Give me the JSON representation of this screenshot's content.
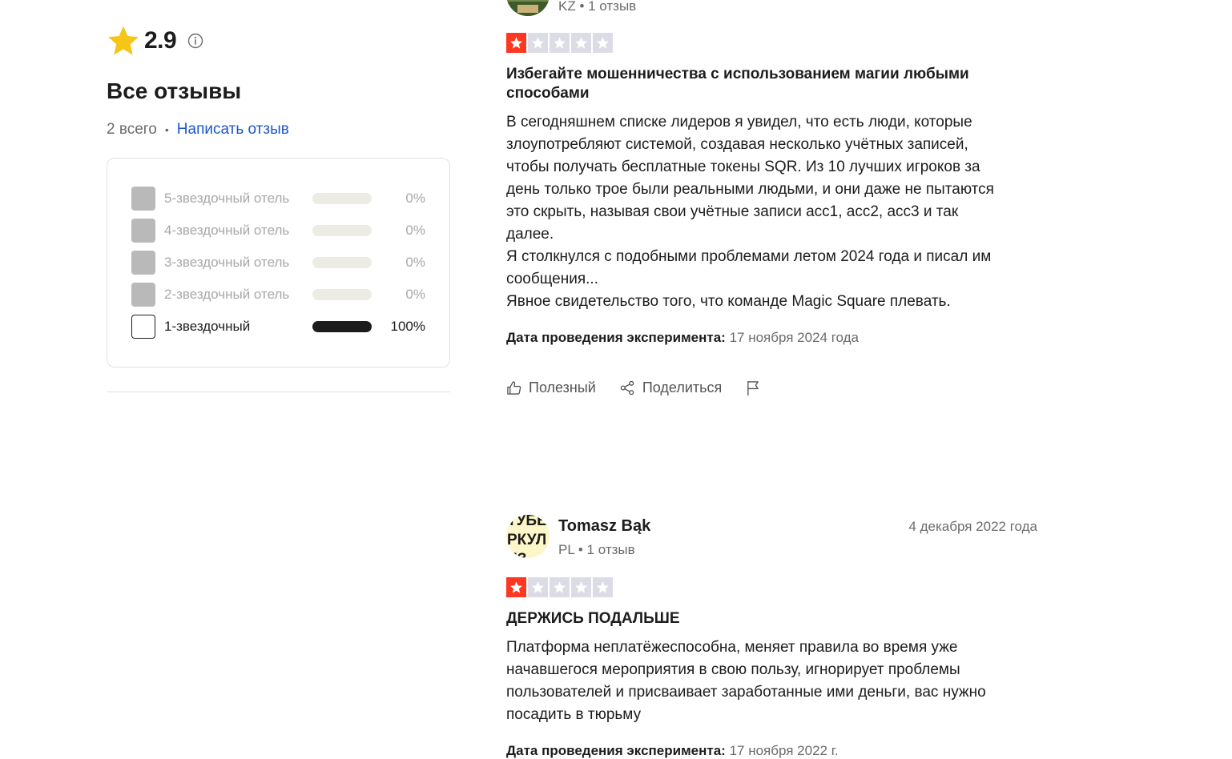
{
  "summary": {
    "rating": "2.9",
    "heading": "Все отзывы",
    "total": "2 всего",
    "write_review": "Написать отзыв"
  },
  "filters": [
    {
      "label": "5-звездочный отель",
      "percent": "0%",
      "fill": 0,
      "enabled": false
    },
    {
      "label": "4-звездочный отель",
      "percent": "0%",
      "fill": 0,
      "enabled": false
    },
    {
      "label": "3-звездочный отель",
      "percent": "0%",
      "fill": 0,
      "enabled": false
    },
    {
      "label": "2-звездочный отель",
      "percent": "0%",
      "fill": 0,
      "enabled": false
    },
    {
      "label": "1-звездочный",
      "percent": "100%",
      "fill": 1,
      "enabled": true
    }
  ],
  "reviews": [
    {
      "author_meta": "KZ • 1 отзыв",
      "stars": 1,
      "title": "Избегайте мошенничества с использованием магии любыми способами",
      "body": [
        "В сегодняшнем списке лидеров я увидел, что есть люди, которые",
        "злоупотребляют системой, создавая несколько учётных записей,",
        "чтобы получать бесплатные токены SQR. Из 10 лучших игроков за",
        "день только трое были реальными людьми, и они даже не пытаются",
        "это скрыть, называя свои учётные записи acc1, acc2, acc3 и так",
        "далее.",
        "Я столкнулся с подобными проблемами летом 2024 года и писал им",
        "сообщения...",
        "Явное свидетельство того, что команде Magic Square плевать."
      ],
      "exp_label": "Дата проведения эксперимента:",
      "exp_value": "17 ноября 2024 года",
      "useful": "Полезный",
      "share": "Поделиться"
    },
    {
      "author_name": "Tomasz Bąk",
      "author_meta": "PL • 1 отзыв",
      "avatar_text": [
        "ТУБЕ",
        "РКУЛ",
        "ЕЗ"
      ],
      "date": "4 декабря 2022 года",
      "stars": 1,
      "title": "ДЕРЖИСЬ ПОДАЛЬШЕ",
      "body": [
        "Платформа неплатёжеспособна, меняет правила во время уже",
        "начавшегося мероприятия в свою пользу, игнорирует проблемы",
        "пользователей и присваивает заработанные ими деньги, вас нужно",
        "посадить в тюрьму"
      ],
      "exp_label": "Дата проведения эксперимента:",
      "exp_value": "17 ноября 2022 г."
    }
  ],
  "colors": {
    "star_gold": "#f5c518",
    "star_red": "#ff3722",
    "star_empty": "#dcdce6",
    "link": "#1a56c9"
  }
}
